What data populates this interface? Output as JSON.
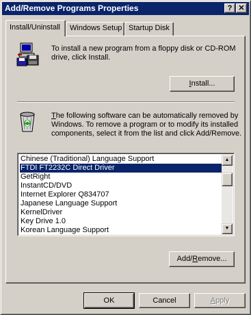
{
  "window": {
    "title": "Add/Remove Programs Properties",
    "help_glyph": "?",
    "close_glyph": "✕"
  },
  "tabs": [
    {
      "label": "Install/Uninstall",
      "active": true
    },
    {
      "label": "Windows Setup",
      "active": false
    },
    {
      "label": "Startup Disk",
      "active": false
    }
  ],
  "install_section": {
    "icon": "computer-floppy-icon",
    "description": "To install a new program from a floppy disk or CD-ROM drive, click Install.",
    "install_button": {
      "mnemonic": "I",
      "rest": "nstall..."
    }
  },
  "remove_section": {
    "icon": "recycle-bin-icon",
    "description_mnemonic": "T",
    "description_rest": "he following software can be automatically removed by Windows. To remove a program or to modify its installed components, select it from the list and click Add/Remove.",
    "programs": [
      "Chinese (Traditional) Language Support",
      "FTDI FT2232C Direct Driver",
      "GetRight",
      "InstantCD/DVD",
      "Internet Explorer Q834707",
      "Japanese Language Support",
      "KernelDriver",
      "Key Drive 1.0",
      "Korean Language Support"
    ],
    "selected_program": "FTDI FT2232C Direct Driver",
    "add_remove_button": {
      "before": "Add/",
      "mnemonic": "R",
      "rest": "emove..."
    },
    "scroll_up_glyph": "▲",
    "scroll_down_glyph": "▼"
  },
  "footer": {
    "ok_label": "OK",
    "cancel_label": "Cancel",
    "apply_mnemonic": "A",
    "apply_rest": "pply"
  },
  "colors": {
    "face": "#d4d0c8",
    "titlebar": "#0a246a",
    "selection": "#0a246a",
    "shadow": "#808080"
  }
}
